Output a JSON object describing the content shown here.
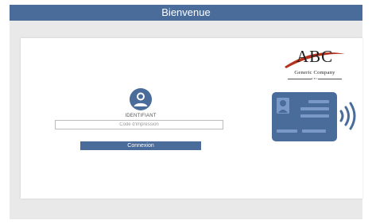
{
  "window": {
    "title": "Bienvenue"
  },
  "login": {
    "identifier_label": "IDENTIFIANT",
    "code_placeholder": "Code d'impression",
    "code_value": "",
    "submit_label": "Connexion"
  },
  "logo": {
    "mark": "ABC",
    "name": "Generic Company",
    "tagline": "ABC"
  },
  "icons": {
    "user": "user-icon",
    "badge": "contactless-badge-icon"
  },
  "colors": {
    "accent": "#4a6c9b",
    "badge": "#4a6c9b",
    "logo_swoosh": "#b5321f"
  }
}
